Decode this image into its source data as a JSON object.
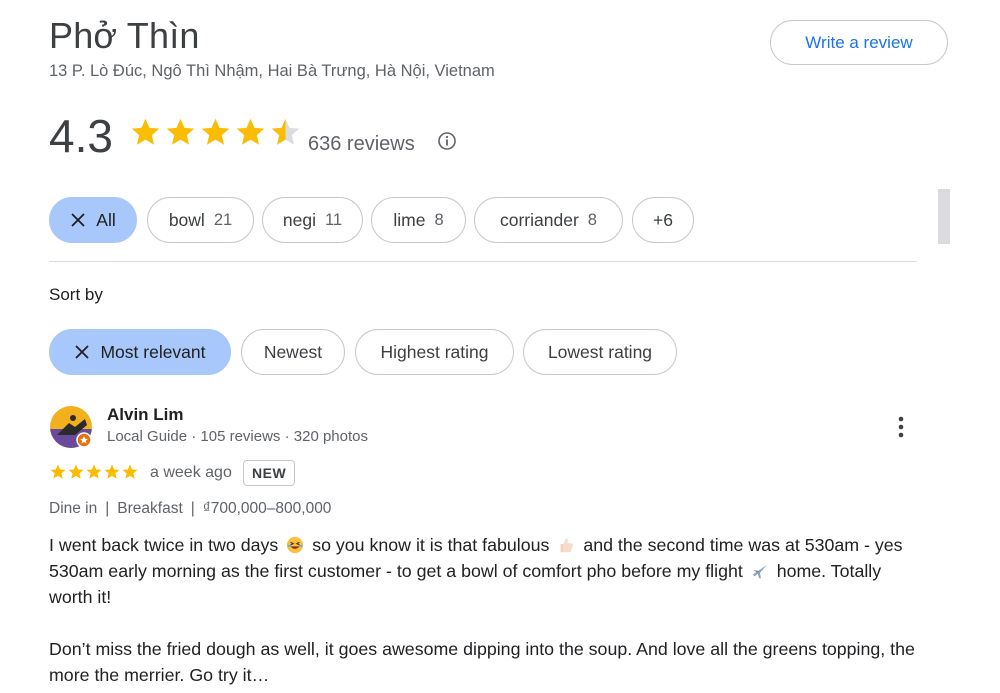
{
  "place": {
    "name": "Phở Thìn",
    "address": "13 P. Lò Đúc, Ngô Thì Nhậm, Hai Bà Trưng, Hà Nội, Vietnam",
    "write_review_label": "Write a review"
  },
  "rating": {
    "value": "4.3",
    "stars_filled": 4.3,
    "review_count": "636 reviews"
  },
  "topic_chips": [
    {
      "label": "All",
      "count": "",
      "selected": true
    },
    {
      "label": "bowl",
      "count": "21",
      "selected": false
    },
    {
      "label": "negi",
      "count": "11",
      "selected": false
    },
    {
      "label": "lime",
      "count": "8",
      "selected": false
    },
    {
      "label": "corriander",
      "count": "8",
      "selected": false
    },
    {
      "label": "+6",
      "count": "",
      "selected": false
    }
  ],
  "sort": {
    "label": "Sort by",
    "options": [
      {
        "label": "Most relevant",
        "selected": true
      },
      {
        "label": "Newest",
        "selected": false
      },
      {
        "label": "Highest rating",
        "selected": false
      },
      {
        "label": "Lowest rating",
        "selected": false
      }
    ]
  },
  "review": {
    "author": "Alvin Lim",
    "author_meta": "Local Guide · 105 reviews · 320 photos",
    "stars": 5,
    "date": "a week ago",
    "badge": "NEW",
    "tags": [
      "Dine in",
      "Breakfast",
      "₫700,000–800,000"
    ],
    "text_p1_a": "I went back twice in two days",
    "text_p1_b": "so you know it is that fabulous",
    "text_p1_c": "and the second time was at 530am - yes 530am early morning as the first customer - to get a bowl of comfort pho before my flight",
    "text_p1_d": "home. Totally worth it!",
    "text_p2": "Don’t miss the fried dough as well, it goes awesome dipping into the soup. And love all the greens topping, the more the merrier. Go try it…"
  },
  "colors": {
    "accent_blue": "#1a73e8",
    "chip_selected": "#a8c7fa",
    "star_gold": "#fbbc04",
    "star_empty": "#dadce0"
  },
  "icons": {
    "info": "info-icon",
    "close": "close-icon",
    "more": "more-vert-icon",
    "emoji_laugh": "grinning-squinting-face",
    "emoji_thumb": "thumbs-up",
    "emoji_plane": "airplane"
  }
}
